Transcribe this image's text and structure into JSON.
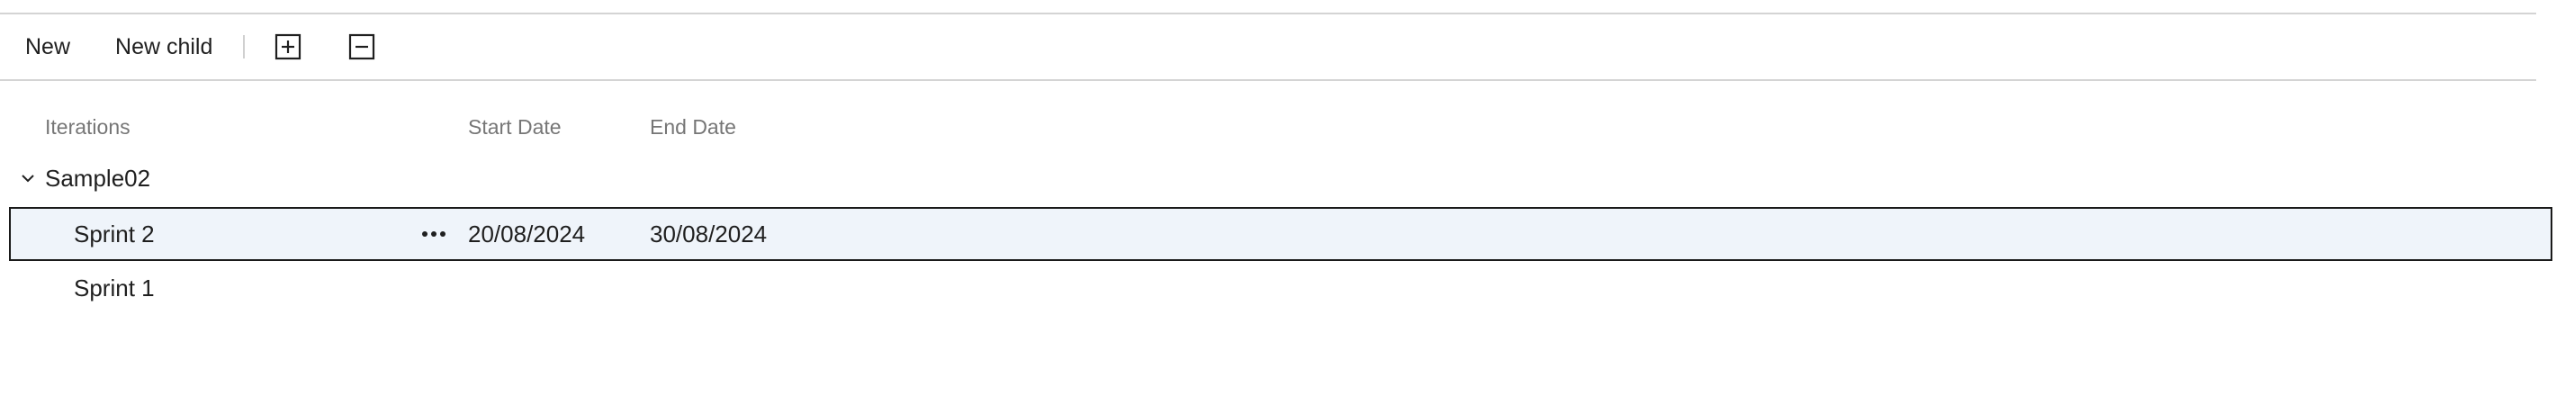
{
  "toolbar": {
    "new_label": "New",
    "new_child_label": "New child",
    "expand_icon": "expand-all-icon",
    "collapse_icon": "collapse-all-icon"
  },
  "columns": {
    "iterations": "Iterations",
    "start_date": "Start Date",
    "end_date": "End Date"
  },
  "tree": {
    "parent": {
      "name": "Sample02",
      "expanded": true
    },
    "children": [
      {
        "name": "Sprint 2",
        "start_date": "20/08/2024",
        "end_date": "30/08/2024",
        "selected": true
      },
      {
        "name": "Sprint 1",
        "start_date": "",
        "end_date": "",
        "selected": false
      }
    ]
  },
  "colors": {
    "selected_row_background": "#eff4fa",
    "selected_row_border": "#1a1a1a",
    "header_text": "#767676",
    "divider": "#d4d4d4"
  }
}
